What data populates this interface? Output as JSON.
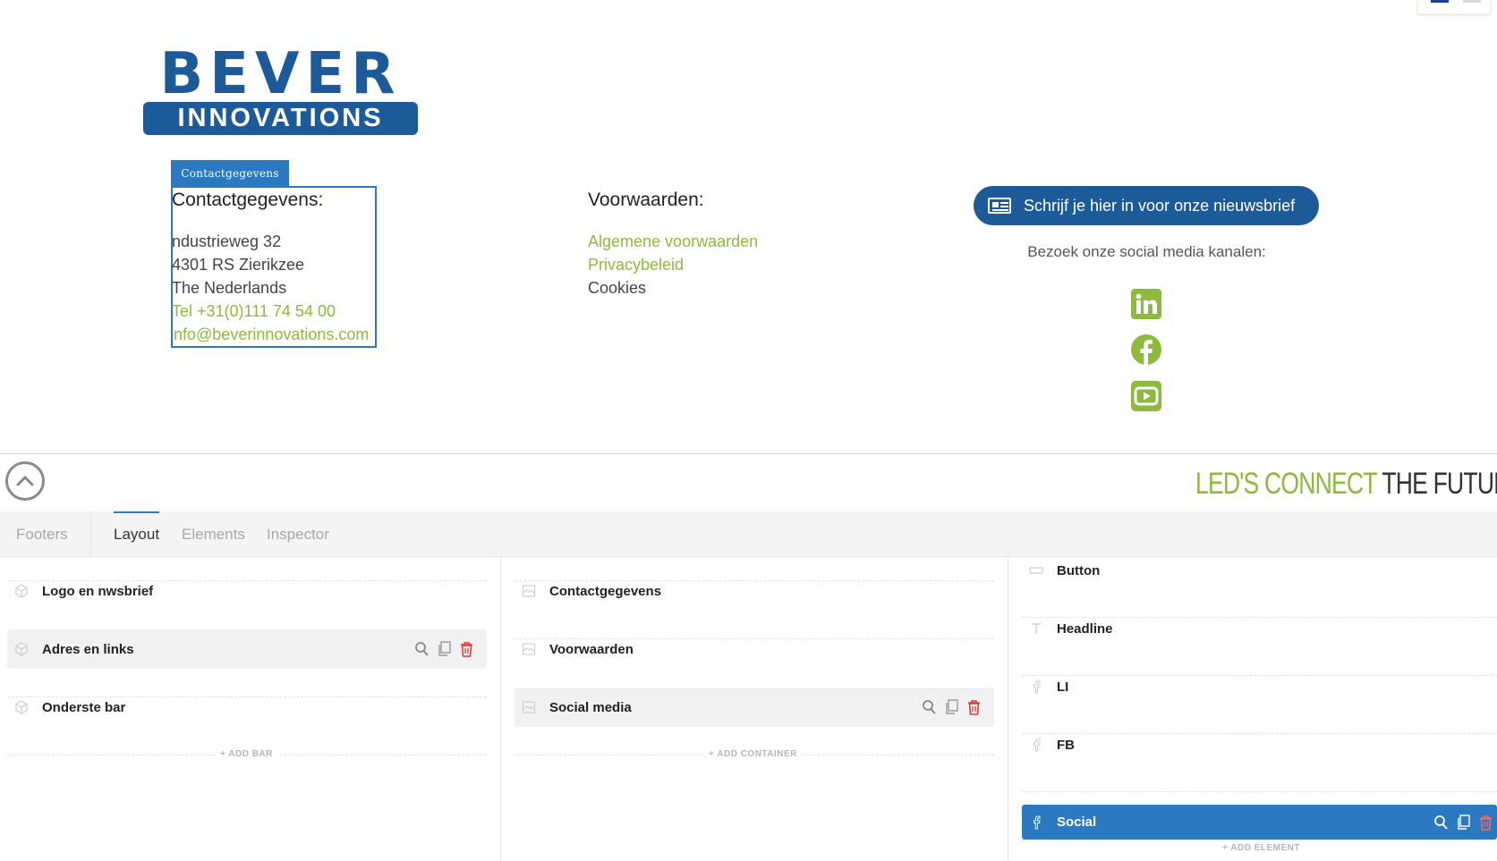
{
  "footer_preview": {
    "logo": {
      "brand": "BEVER",
      "sub": "INNOVATIONS"
    },
    "selection_tag": "Contactgegevens",
    "contact": {
      "title": "Contactgegevens:",
      "lines": [
        "ndustrieweg 32",
        "4301 RS Zierikzee",
        "The Nederlands"
      ],
      "phone": "Tel +31(0)111 74 54 00",
      "email": "nfo@beverinnovations.com"
    },
    "terms": {
      "title": "Voorwaarden:",
      "links": [
        "Algemene voorwaarden",
        "Privacybeleid"
      ],
      "cookies": "Cookies"
    },
    "newsletter_button": "Schrijf je hier in voor onze nieuwsbrief",
    "social_label": "Bezoek onze social media kanalen:",
    "social_icons": [
      "linkedin-icon",
      "facebook-icon",
      "youtube-icon"
    ],
    "slogan": {
      "part1": "LED'S CONNECT",
      "part2": " THE FUTURE"
    }
  },
  "builder": {
    "tabs": [
      "Footers",
      "Layout",
      "Elements",
      "Inspector"
    ],
    "active_tab": "Layout",
    "bars": [
      "Logo en nwsbrief",
      "Adres en links",
      "Onderste bar"
    ],
    "add_bar": "+ ADD BAR",
    "containers": [
      "Contactgegevens",
      "Voorwaarden",
      "Social media"
    ],
    "add_container": "+ ADD CONTAINER",
    "elements": [
      "Button",
      "Headline",
      "LI",
      "FB",
      "Social"
    ],
    "add_element": "+ ADD ELEMENT"
  },
  "colors": {
    "brand_blue": "#1c5a99",
    "accent_green": "#8dba3c",
    "select_blue": "#2a79c1",
    "delete_red": "#e03b3b"
  }
}
